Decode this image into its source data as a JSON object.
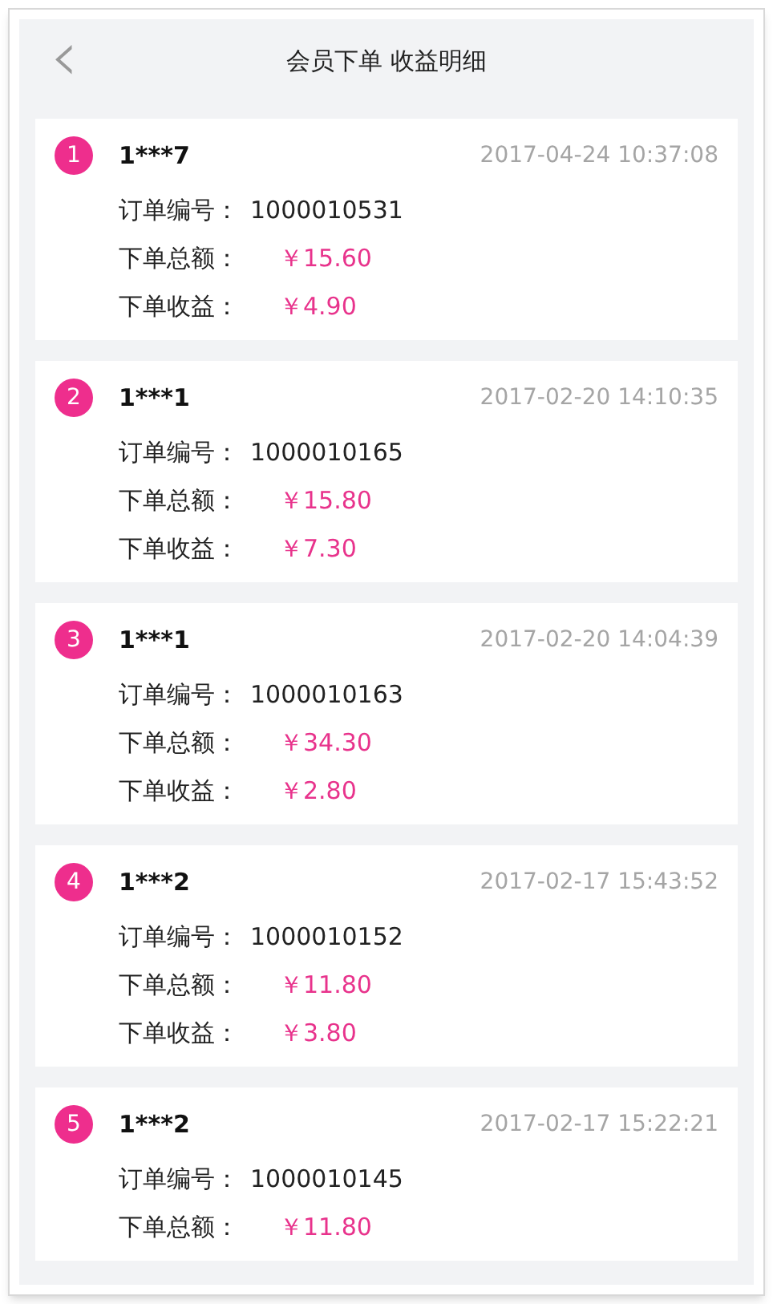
{
  "header": {
    "back": "‹",
    "title": "会员下单 收益明细"
  },
  "orders": [
    {
      "index": "1",
      "member": "1***7",
      "time": "2017-04-24 10:37:08",
      "fields": [
        {
          "kind": "id",
          "label": "订单编号：",
          "value": "1000010531"
        },
        {
          "kind": "amount",
          "label": "下单总额：",
          "value": "￥15.60"
        },
        {
          "kind": "amount",
          "label": "下单收益：",
          "value": "￥4.90"
        }
      ]
    },
    {
      "index": "2",
      "member": "1***1",
      "time": "2017-02-20 14:10:35",
      "fields": [
        {
          "kind": "id",
          "label": "订单编号：",
          "value": "1000010165"
        },
        {
          "kind": "amount",
          "label": "下单总额：",
          "value": "￥15.80"
        },
        {
          "kind": "amount",
          "label": "下单收益：",
          "value": "￥7.30"
        }
      ]
    },
    {
      "index": "3",
      "member": "1***1",
      "time": "2017-02-20 14:04:39",
      "fields": [
        {
          "kind": "id",
          "label": "订单编号：",
          "value": "1000010163"
        },
        {
          "kind": "amount",
          "label": "下单总额：",
          "value": "￥34.30"
        },
        {
          "kind": "amount",
          "label": "下单收益：",
          "value": "￥2.80"
        }
      ]
    },
    {
      "index": "4",
      "member": "1***2",
      "time": "2017-02-17 15:43:52",
      "fields": [
        {
          "kind": "id",
          "label": "订单编号：",
          "value": "1000010152"
        },
        {
          "kind": "amount",
          "label": "下单总额：",
          "value": "￥11.80"
        },
        {
          "kind": "amount",
          "label": "下单收益：",
          "value": "￥3.80"
        }
      ]
    },
    {
      "index": "5",
      "member": "1***2",
      "time": "2017-02-17 15:22:21",
      "fields": [
        {
          "kind": "id",
          "label": "订单编号：",
          "value": "1000010145"
        },
        {
          "kind": "amount",
          "label": "下单总额：",
          "value": "￥11.80"
        }
      ]
    }
  ]
}
